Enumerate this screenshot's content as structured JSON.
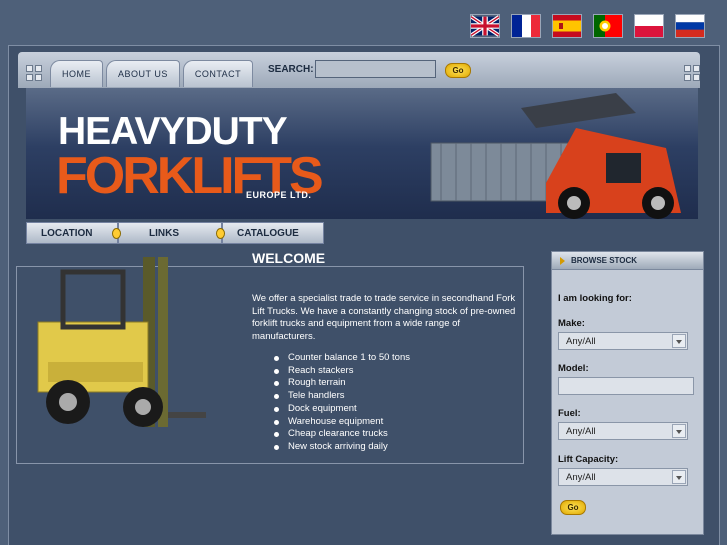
{
  "flags": [
    {
      "icon": "uk-flag-icon"
    },
    {
      "icon": "france-flag-icon"
    },
    {
      "icon": "spain-flag-icon"
    },
    {
      "icon": "portugal-flag-icon"
    },
    {
      "icon": "poland-flag-icon"
    },
    {
      "icon": "russia-flag-icon"
    }
  ],
  "nav": {
    "home": "HOME",
    "about": "ABOUT US",
    "contact": "CONTACT"
  },
  "search": {
    "label": "SEARCH:",
    "value": "",
    "go": "Go"
  },
  "brand": {
    "line1": "HEAVYDUTY",
    "line2": "FORKLIFTS",
    "line3": "EUROPE LTD."
  },
  "subnav": {
    "location": "LOCATION",
    "links": "LINKS",
    "catalogue": "CATALOGUE"
  },
  "welcome": {
    "title": "WELCOME",
    "intro": "We offer a specialist trade to trade service in secondhand Fork Lift Trucks. We have a constantly changing stock of pre-owned forklift trucks and equipment from a wide range of manufacturers.",
    "services": [
      "Counter balance 1 to 50 tons",
      "Reach stackers",
      "Rough terrain",
      "Tele handlers",
      "Dock equipment",
      "Warehouse equipment",
      "Cheap clearance trucks",
      "New stock arriving daily"
    ]
  },
  "browse": {
    "title": "BROWSE STOCK",
    "looking_for": "I am looking for:",
    "make_label": "Make:",
    "make_value": "Any/All",
    "model_label": "Model:",
    "model_value": "",
    "fuel_label": "Fuel:",
    "fuel_value": "Any/All",
    "capacity_label": "Lift Capacity:",
    "capacity_value": "Any/All",
    "go": "Go"
  },
  "colors": {
    "accent": "#e85a1a",
    "button": "#ffcc33",
    "background": "#4e6079"
  }
}
